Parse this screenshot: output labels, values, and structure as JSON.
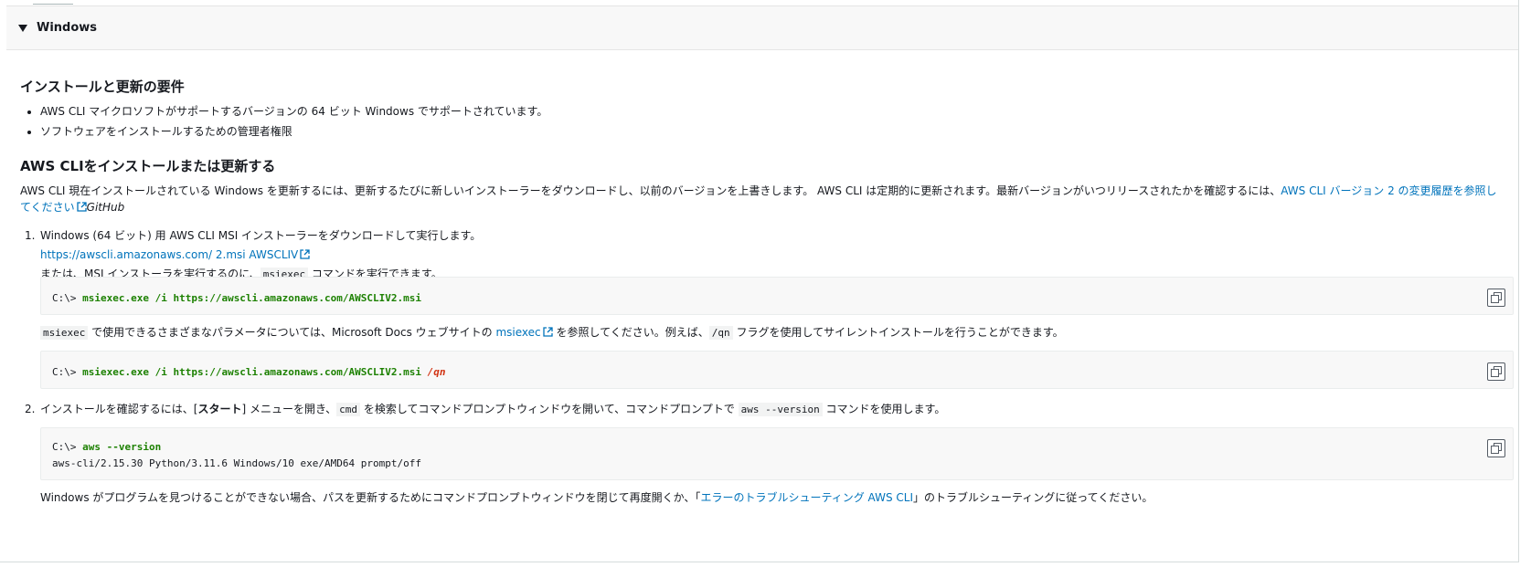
{
  "expander": {
    "title": "Windows",
    "icon": "caret-down-icon"
  },
  "requirements": {
    "heading": "インストールと更新の要件",
    "items": [
      "AWS CLI マイクロソフトがサポートするバージョンの 64 ビット Windows でサポートされています。",
      "ソフトウェアをインストールするための管理者権限"
    ]
  },
  "install": {
    "heading": "AWS CLIをインストールまたは更新する",
    "intro_text": "AWS CLI 現在インストールされている Windows を更新するには、更新するたびに新しいインストーラーをダウンロードし、以前のバージョンを上書きします。 AWS CLI は定期的に更新されます。最新バージョンがいつリリースされたかを確認するには、",
    "intro_link": "AWS CLI バージョン 2 の変更履歴を参照してください",
    "intro_suffix": "GitHub"
  },
  "step1": {
    "number": "1.",
    "text": "Windows (64 ビット) 用 AWS CLI MSI インストーラーをダウンロードして実行します。",
    "link": "https://awscli.amazonaws.com/ 2.msi AWSCLIV",
    "alt_prefix": "または、MSI インストーラを実行するのに、",
    "alt_code": "msiexec",
    "alt_suffix": " コマンドを実行できます。",
    "code1_prompt": "C:\\> ",
    "code1_cmd": "msiexec.exe /i https://awscli.amazonaws.com/AWSCLIV2.msi",
    "param_code": "msiexec",
    "param_text1": " で使用できるさまざまなパラメータについては、Microsoft Docs ウェブサイトの ",
    "param_link": "msiexec",
    "param_text2": " を参照してください。例えば、",
    "param_flag": "/qn",
    "param_text3": " フラグを使用してサイレントインストールを行うことができます。",
    "code2_prompt": "C:\\> ",
    "code2_cmd": "msiexec.exe /i https://awscli.amazonaws.com/AWSCLIV2.msi ",
    "code2_flag": "/qn"
  },
  "step2": {
    "number": "2.",
    "text1": "インストールを確認するには、[",
    "menu": "スタート",
    "text2": "] メニューを開き、",
    "code_cmd": "cmd",
    "text3": " を検索してコマンドプロンプトウィンドウを開いて、コマンドプロンプトで ",
    "code_ver": "aws --version",
    "text4": " コマンドを使用します。",
    "code_prompt": "C:\\> ",
    "code_cmd_line": "aws --version",
    "code_output": "aws-cli/2.15.30 Python/3.11.6 Windows/10 exe/AMD64 prompt/off",
    "trouble_prefix": "Windows がプログラムを見つけることができない場合、パスを更新するためにコマンドプロンプトウィンドウを閉じて再度開くか、「",
    "trouble_link": "エラーのトラブルシューティング AWS CLI",
    "trouble_suffix": "」のトラブルシューティングに従ってください。"
  },
  "colors": {
    "link": "#0073bb",
    "command": "#1d8102",
    "flag": "#d13212"
  }
}
